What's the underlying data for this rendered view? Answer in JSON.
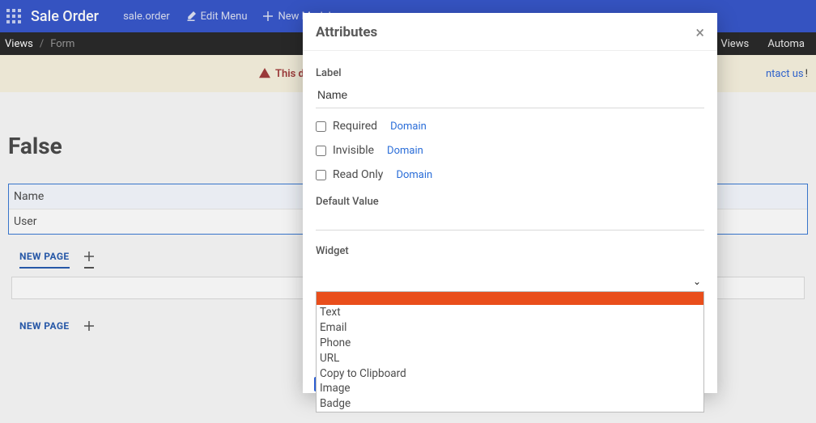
{
  "topbar": {
    "title": "Sale Order",
    "model": "sale.order",
    "edit_menu_label": "Edit Menu",
    "new_model_label": "New Model"
  },
  "secondbar": {
    "crumb1": "Views",
    "crumb2": "Form",
    "right_views": "Views",
    "right_automa": "Automa"
  },
  "warnbar": {
    "warning_text": "This d",
    "contact_text": "ntact us",
    "exclam": "!"
  },
  "page": {
    "title_false": "False",
    "field_list": [
      "Name",
      "User"
    ],
    "new_page_label": "NEW PAGE"
  },
  "modal": {
    "title": "Attributes",
    "labels": {
      "label": "Label",
      "required": "Required",
      "invisible": "Invisible",
      "readonly": "Read Only",
      "domain": "Domain",
      "default_value": "Default Value",
      "widget": "Widget"
    },
    "label_value": "Name",
    "widget_options": [
      "",
      "Text",
      "Email",
      "Phone",
      "URL",
      "Copy to Clipboard",
      "Image",
      "Badge"
    ]
  }
}
